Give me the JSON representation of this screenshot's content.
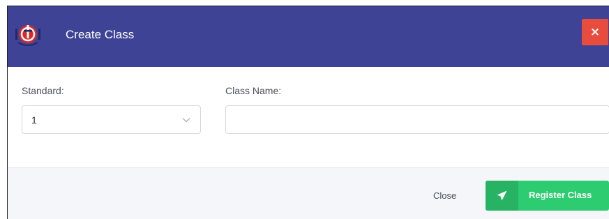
{
  "modal": {
    "title": "Create Class",
    "close_icon_glyph": "×",
    "logo_icon": "school-logo"
  },
  "form": {
    "standard": {
      "label": "Standard:",
      "selected": "1",
      "icon": "chevron-down-icon"
    },
    "class_name": {
      "label": "Class Name:",
      "value": "",
      "placeholder": ""
    }
  },
  "footer": {
    "close_label": "Close",
    "register_label": "Register Class",
    "register_icon": "paper-plane-icon"
  },
  "colors": {
    "header_bg": "#3e4396",
    "close_button_bg": "#e74c3c",
    "register_button_bg": "#2ecc71",
    "footer_bg": "#f4f6f9"
  }
}
